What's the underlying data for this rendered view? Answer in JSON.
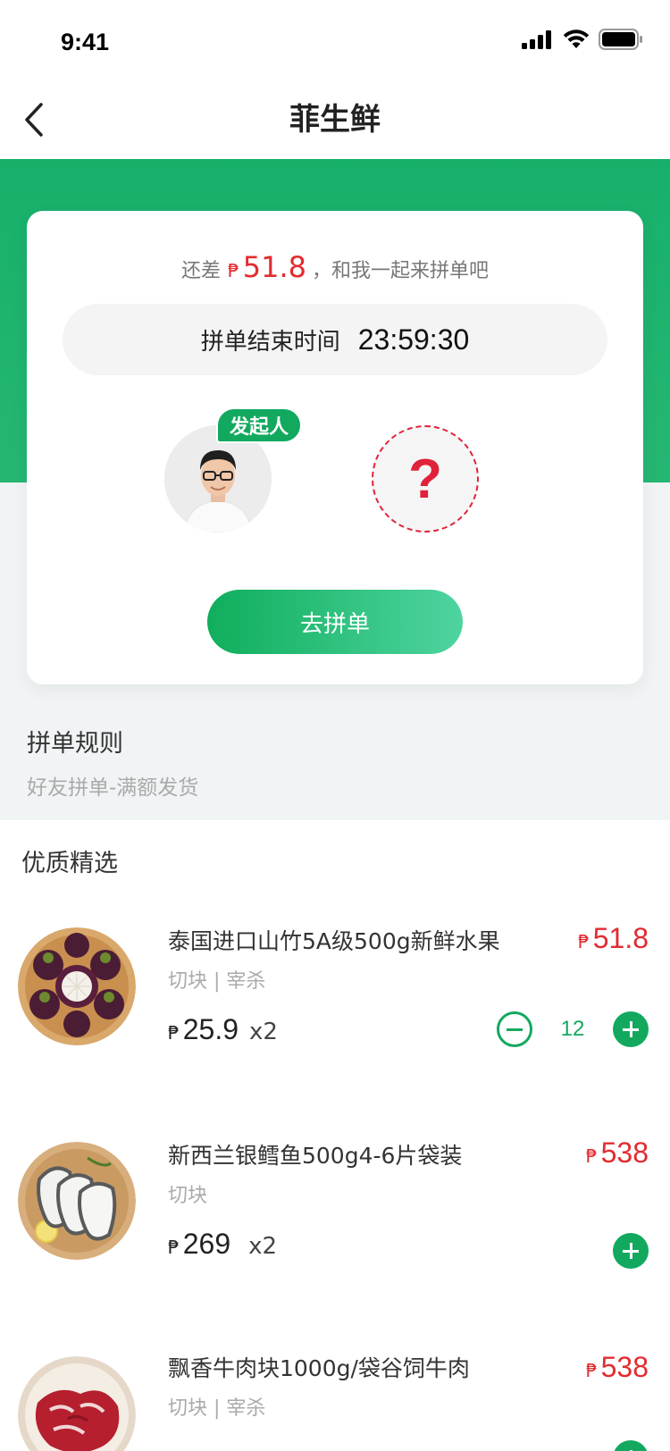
{
  "status_bar": {
    "time": "9:41"
  },
  "nav": {
    "title": "菲生鲜"
  },
  "group": {
    "remaining_prefix": "还差",
    "remaining_currency": "₱",
    "remaining_amount": "51.8",
    "remaining_suffix": "，和我一起来拼单吧",
    "timer_label": "拼单结束时间",
    "timer_value": "23:59:30",
    "initiator_badge": "发起人",
    "empty_slot_symbol": "?",
    "join_button": "去拼单"
  },
  "rules": {
    "title": "拼单规则",
    "description": "好友拼单-满额发货"
  },
  "section_title": "优质精选",
  "products": [
    {
      "name": "泰国进口山竹5A级500g新鲜水果",
      "tags": "切块 | 宰杀",
      "currency": "₱",
      "unit_price": "25.9",
      "qty_label": "x2",
      "total_price": "51.8",
      "stepper_value": "12",
      "image_icon": "mangosteen-image"
    },
    {
      "name": "新西兰银鳕鱼500g4-6片袋装",
      "tags": "切块",
      "currency": "₱",
      "unit_price": "269",
      "qty_label": "x2",
      "total_price": "538",
      "image_icon": "cod-fish-image"
    },
    {
      "name": "飘香牛肉块1000g/袋谷饲牛肉",
      "tags": "切块 | 宰杀",
      "currency": "₱",
      "total_price": "538",
      "image_icon": "beef-image"
    }
  ],
  "colors": {
    "brand_green": "#12a95f",
    "price_red": "#e22b2f"
  }
}
